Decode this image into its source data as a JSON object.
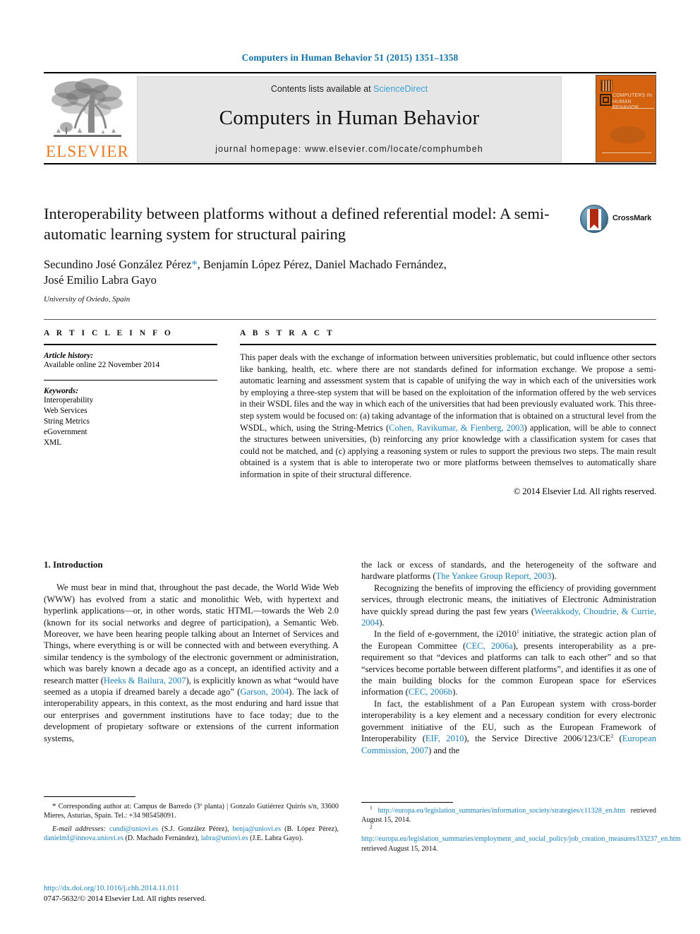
{
  "running_head": "Computers in Human Behavior 51 (2015) 1351–1358",
  "header": {
    "publisher_name": "ELSEVIER",
    "contents_prefix": "Contents lists available at ",
    "contents_link": "ScienceDirect",
    "journal_title": "Computers in Human Behavior",
    "homepage": "journal homepage: www.elsevier.com/locate/comphumbeh",
    "cover_title": "COMPUTERS IN HUMAN BEHAVIOR"
  },
  "article": {
    "title": "Interoperability between platforms without a defined referential model: A semi-automatic learning system for structural pairing",
    "authors_line1_a": "Secundino José González Pérez",
    "authors_star": "*",
    "authors_line1_b": ", Benjamín López Pérez, Daniel Machado Fernández,",
    "authors_line2": "José Emilio Labra Gayo",
    "affiliation": "University of Oviedo, Spain",
    "crossmark_label": "CrossMark"
  },
  "info": {
    "heading": "A R T I C L E   I N F O",
    "history_label": "Article history:",
    "history_value": "Available online 22 November 2014",
    "keywords_label": "Keywords:",
    "keywords": [
      "Interoperability",
      "Web Services",
      "String Metrics",
      "eGovernment",
      "XML"
    ]
  },
  "abstract": {
    "heading": "A B S T R A C T",
    "part1": "This paper deals with the exchange of information between universities problematic, but could influence other sectors like banking, health, etc. where there are not standards defined for information exchange. We propose a semi-automatic learning and assessment system that is capable of unifying the way in which each of the universities work by employing a three-step system that will be based on the exploitation of the information offered by the web services in their WSDL files and the way in which each of the universities that had been previously evaluated work. This three-step system would be focused on: (a) taking advantage of the information that is obtained on a structural level from the WSDL, which, using the String-Metrics (",
    "citation1": "Cohen, Ravikumar, & Fienberg, 2003",
    "part2": ") application, will be able to connect the structures between universities, (b) reinforcing any prior knowledge with a classification system for cases that could not be matched, and (c) applying a reasoning system or rules to support the previous two steps. The main result obtained is a system that is able to interoperate two or more platforms between themselves to automatically share information in spite of their structural difference.",
    "copyright": "© 2014 Elsevier Ltd. All rights reserved."
  },
  "body": {
    "section_title": "1. Introduction",
    "left": {
      "p1_a": "We must bear in mind that, throughout the past decade, the World Wide Web (WWW) has evolved from a static and monolithic Web, with hypertext and hyperlink applications—or, in other words, static HTML—towards the Web 2.0 (known for its social networks and degree of participation), a Semantic Web. Moreover, we have been hearing people talking about an Internet of Services and Things, where everything is or will be connected with and between everything. A similar tendency is the symbology of the electronic government or administration, which was barely known a decade ago as a concept, an identified activity and a research matter (",
      "cite1": "Heeks & Bailura, 2007",
      "p1_b": "), is explicitly known as what “would have seemed as a utopia if dreamed barely a decade ago” (",
      "cite2": "Garson, 2004",
      "p1_c": "). The lack of interoperability appears, in this context, as the most enduring and hard issue that our enterprises and government institutions have to face today; due to the development of propietary software or extensions of the current information systems,"
    },
    "right": {
      "p1_a": "the lack or excess of standards, and the heterogeneity of the software and hardware platforms (",
      "cite1": "The Yankee Group Report, 2003",
      "p1_b": ").",
      "p2_a": "Recognizing the benefits of improving the efficiency of providing government services, through electronic means, the initiatives of Electronic Administration have quickly spread during the past few years (",
      "cite2": "Weerakkody, Choudrie, & Currie, 2004",
      "p2_b": ").",
      "p3_a": "In the field of e-government, the i2010",
      "p3_sup": "1",
      "p3_b": " initiative, the strategic action plan of the European Committee (",
      "cite3": "CEC, 2006a",
      "p3_c": "), presents interoperability as a pre-requirement so that “devices and platforms can talk to each other” and so that “services become portable between different platforms”, and identifies it as one of the main building blocks for the common European space for eServices information (",
      "cite4": "CEC, 2006b",
      "p3_d": ").",
      "p4_a": "In fact, the establishment of a Pan European system with cross-border interoperability is a key element and a necessary condition for every electronic government initiative of the EU, such as the European Framework of Interoperability (",
      "cite5": "EIF, 2010",
      "p4_b": "), the Service Directive 2006/123/CE",
      "p4_sup": "2",
      "p4_c": " (",
      "cite6": "European Commission, 2007",
      "p4_d": ") and the"
    }
  },
  "footnotes": {
    "left": {
      "star": "*",
      "corresponding": " Corresponding author at: Campus de Barredo (3º planta) | Gonzalo Gutiérrez Quirós s/n, 33600 Mieres, Asturias, Spain. Tel.: +34 985458091.",
      "email_label": "E-mail addresses:",
      "email1": "cundi@uniovi.es",
      "email1_owner": " (S.J. González Pérez), ",
      "email2": "benja@uniovi.es",
      "email2_owner": " (B. López Pérez), ",
      "email3": "danielmf@innova.uniovi.es",
      "email3_owner": " (D. Machado Fernández), ",
      "email4": "labra@uniovi.es",
      "email4_owner": " (J.E. Labra Gayo)."
    },
    "right": {
      "sup1": "1",
      "url1": "http://europa.eu/legislation_summaries/information_society/strategies/c11328_en.htm",
      "retrieved1": " retrieved August 15, 2014.",
      "sup2": "2",
      "url2": "http://europa.eu/legislation_summaries/employment_and_social_policy/job_creation_measures/l33237_en.htm",
      "retrieved2": " retrieved August 15, 2014."
    }
  },
  "doi": {
    "url": "http://dx.doi.org/10.1016/j.chb.2014.11.011",
    "issn_line": "0747-5632/© 2014 Elsevier Ltd. All rights reserved."
  },
  "colors": {
    "link": "#1a7fb5",
    "runhead": "#1273a8",
    "elsevier_orange": "#e87722",
    "cover_orange": "#d4620f",
    "band_gray": "#e6e6e6"
  }
}
